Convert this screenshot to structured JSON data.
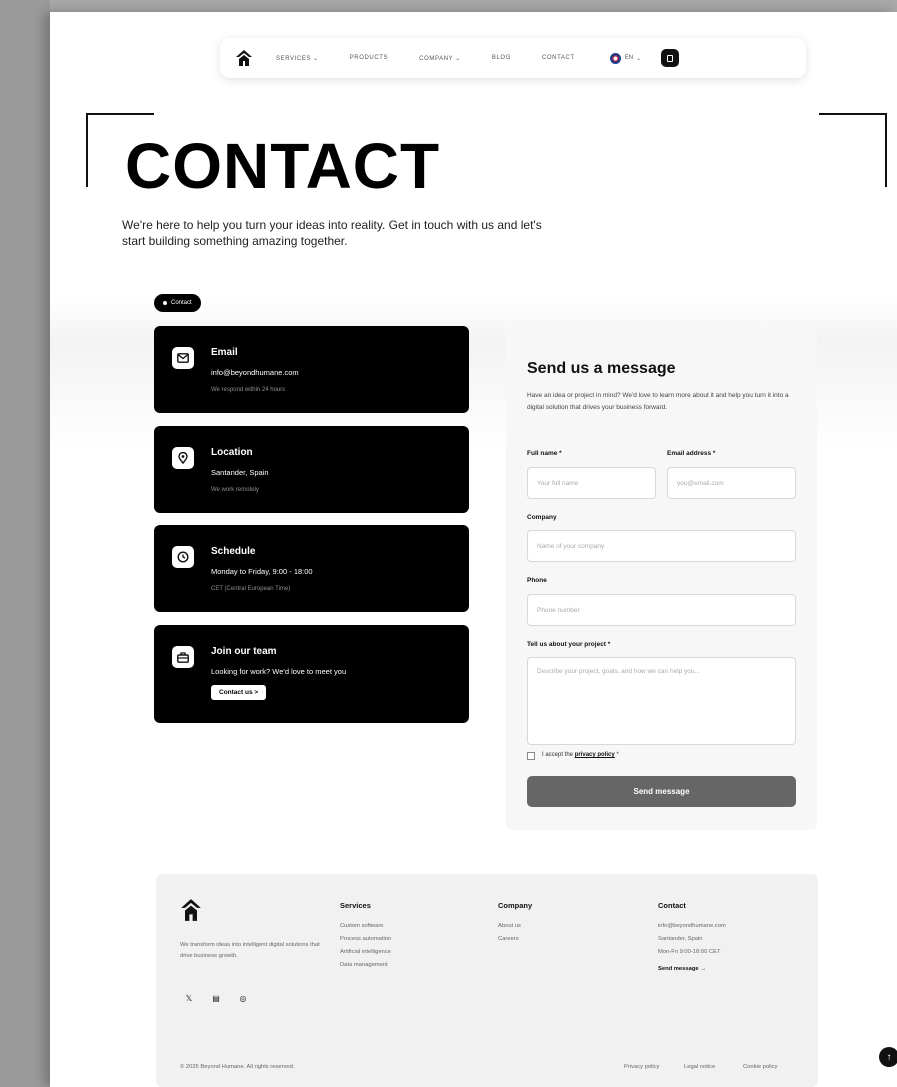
{
  "nav": {
    "items": [
      "SERVICES",
      "PRODUCTS",
      "COMPANY",
      "BLOG",
      "CONTACT"
    ],
    "language": "EN"
  },
  "hero": {
    "title": "CONTACT",
    "intro": "We're here to help you turn your ideas into reality. Get in touch with us and let's start building something amazing together."
  },
  "badge": "Contact",
  "cards": [
    {
      "title": "Email",
      "value": "info@beyondhumane.com",
      "sub": "We respond within 24 hours",
      "icon": "envelope-icon"
    },
    {
      "title": "Location",
      "value": "Santander, Spain",
      "sub": "We work remotely",
      "icon": "map-pin-icon"
    },
    {
      "title": "Schedule",
      "value": "Monday to Friday, 9:00 - 18:00",
      "sub": "CET (Central European Time)",
      "icon": "clock-icon"
    },
    {
      "title": "Join our team",
      "value": "Looking for work? We'd love to meet you",
      "button": "Contact us  >",
      "icon": "briefcase-icon"
    }
  ],
  "form": {
    "title": "Send us a message",
    "description": "Have an idea or project in mind? We'd love to learn more about it and help you turn it into a digital solution that drives your business forward.",
    "full_name_label": "Full name *",
    "full_name_placeholder": "Your full name",
    "email_label": "Email address *",
    "email_placeholder": "you@email.com",
    "company_label": "Company",
    "company_placeholder": "Name of your company",
    "phone_label": "Phone",
    "phone_placeholder": "Phone number",
    "project_label": "Tell us about your project *",
    "project_placeholder": "Describe your project, goals, and how we can help you...",
    "consent_prefix": "I accept the",
    "consent_link": "privacy policy",
    "consent_suffix": "*",
    "submit": "Send message"
  },
  "footer": {
    "tagline": "We transform ideas into intelligent digital solutions that drive business growth.",
    "services_title": "Services",
    "services": [
      "Custom software",
      "Process automation",
      "Artificial intelligence",
      "Data management"
    ],
    "company_title": "Company",
    "company": [
      "About us",
      "Careers"
    ],
    "contact_title": "Contact",
    "contact": [
      "info@beyondhumane.com",
      "Santander, Spain",
      "Mon-Fri 9:00-18:00 CET"
    ],
    "send_link": "Send message →",
    "copyright": "© 2025 Beyond Humane. All rights reserved.",
    "legal": [
      "Privacy policy",
      "Legal notice",
      "Cookie policy"
    ]
  }
}
